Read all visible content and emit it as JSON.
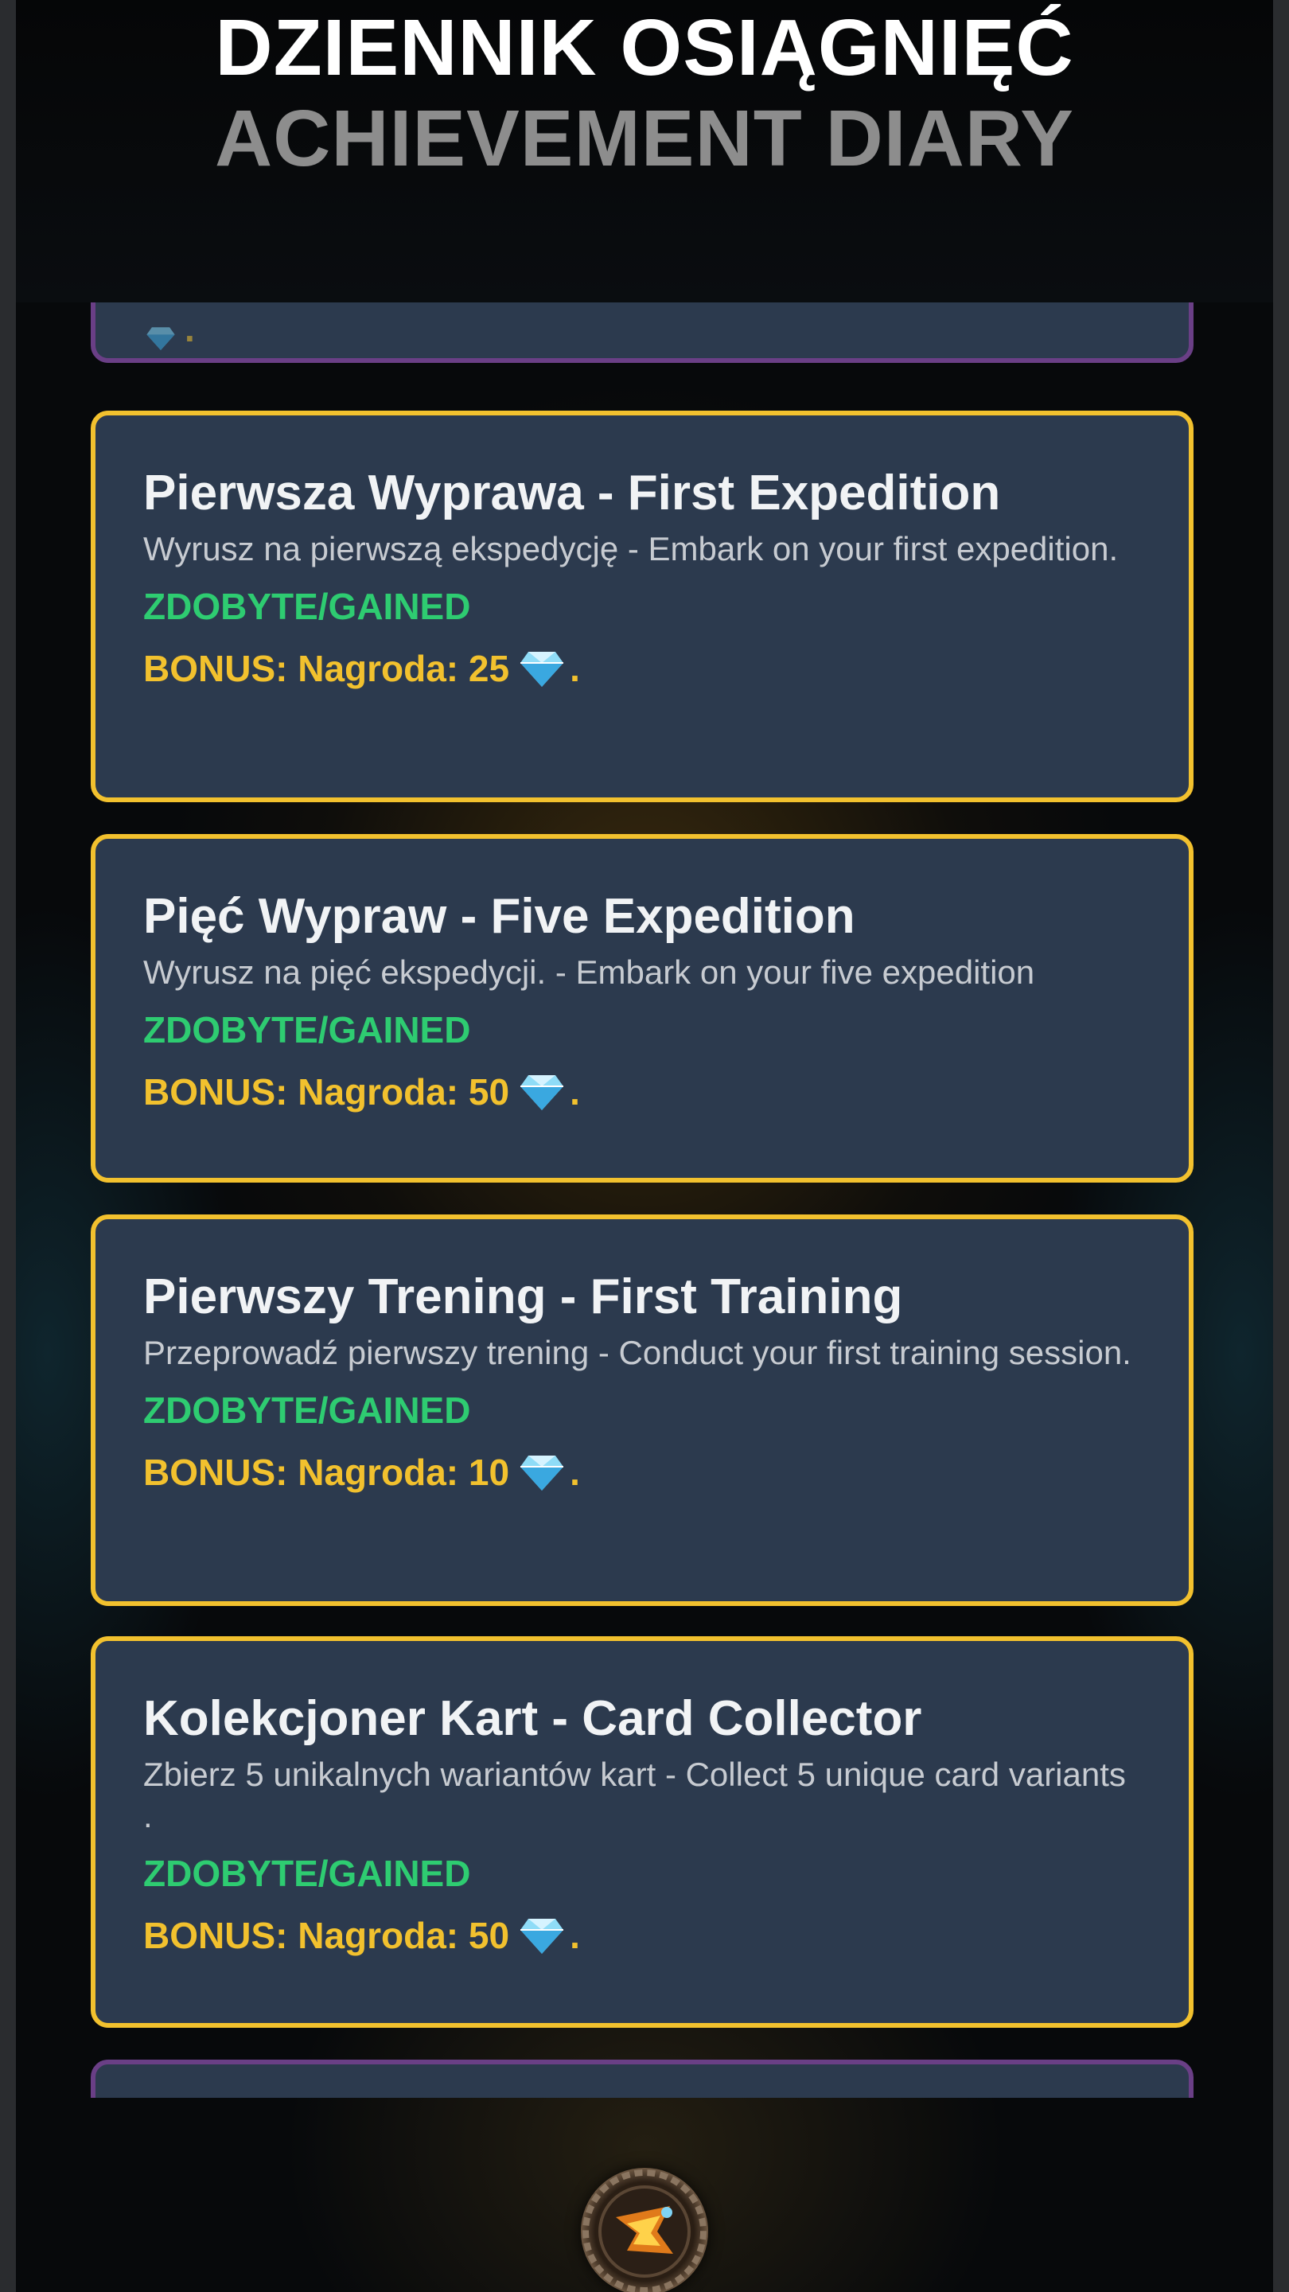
{
  "header": {
    "title_pl": "DZIENNIK OSIĄGNIĘĆ",
    "title_en": "ACHIEVEMENT DIARY"
  },
  "achievements": [
    {
      "title": "Pierwsza Wyprawa - First Expedition",
      "description": "Wyrusz na pierwszą ekspedycję - Embark on your first expedition.",
      "status": "ZDOBYTE/GAINED",
      "bonus": "BONUS: Nagroda: 25",
      "bonus_suffix": "."
    },
    {
      "title": "Pięć Wypraw - Five Expedition",
      "description": "Wyrusz na pięć ekspedycji. - Embark on your five expedition",
      "status": "ZDOBYTE/GAINED",
      "bonus": "BONUS: Nagroda: 50",
      "bonus_suffix": "."
    },
    {
      "title": "Pierwszy Trening - First Training",
      "description": "Przeprowadź pierwszy trening - Conduct your first training session.",
      "status": "ZDOBYTE/GAINED",
      "bonus": "BONUS: Nagroda: 10",
      "bonus_suffix": "."
    },
    {
      "title": "Kolekcjoner Kart - Card Collector",
      "description": "Zbierz 5 unikalnych wariantów kart - Collect 5 unique card variants .",
      "status": "ZDOBYTE/GAINED",
      "bonus": "BONUS: Nagroda: 50",
      "bonus_suffix": "."
    }
  ],
  "partial_card_top": {
    "text": "."
  },
  "icons": {
    "reward": "diamond-gem-icon",
    "nav": "expedition-medallion-icon"
  },
  "colors": {
    "card_bg": "#2c3a4e",
    "earned_border": "#f2c12e",
    "unearned_border": "#6a3f86",
    "status_gained": "#2ecc71",
    "bonus_text": "#f2c12e",
    "title_en": "#8d8d8d"
  }
}
